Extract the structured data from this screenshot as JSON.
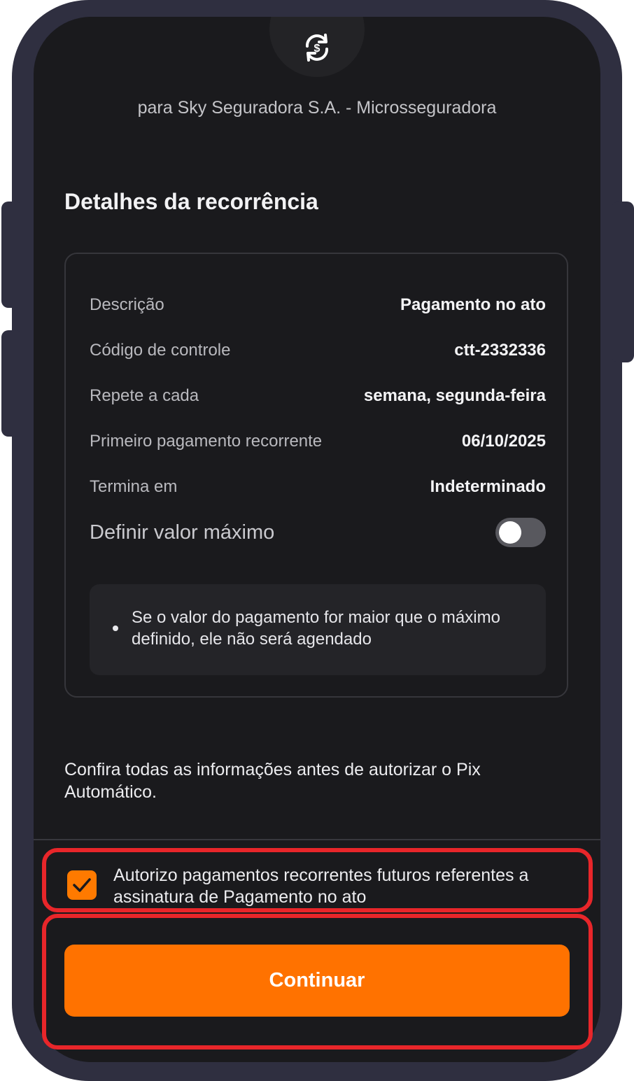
{
  "header": {
    "icon": "recurring-payment-icon",
    "recipient": "para Sky Seguradora S.A. - Microsseguradora"
  },
  "details": {
    "title": "Detalhes da recorrência",
    "rows": [
      {
        "label": "Descrição",
        "value": "Pagamento no ato"
      },
      {
        "label": "Código de controle",
        "value": "ctt-2332336"
      },
      {
        "label": "Repete a cada",
        "value": "semana, segunda-feira"
      },
      {
        "label": "Primeiro pagamento recorrente",
        "value": "06/10/2025"
      },
      {
        "label": "Termina em",
        "value": "Indeterminado"
      }
    ],
    "max_value": {
      "label": "Definir valor máximo",
      "enabled": false
    },
    "info": "Se o valor do pagamento for maior que o máximo definido, ele não será agendado"
  },
  "confirm_text": "Confira todas as informações antes de autorizar o Pix Automático.",
  "authorization": {
    "checked": true,
    "label": "Autorizo pagamentos recorrentes futuros referentes a assinatura de Pagamento no ato"
  },
  "continue_label": "Continuar",
  "colors": {
    "accent": "#ff7200",
    "background": "#1a1a1d",
    "highlight": "#e8262a"
  }
}
